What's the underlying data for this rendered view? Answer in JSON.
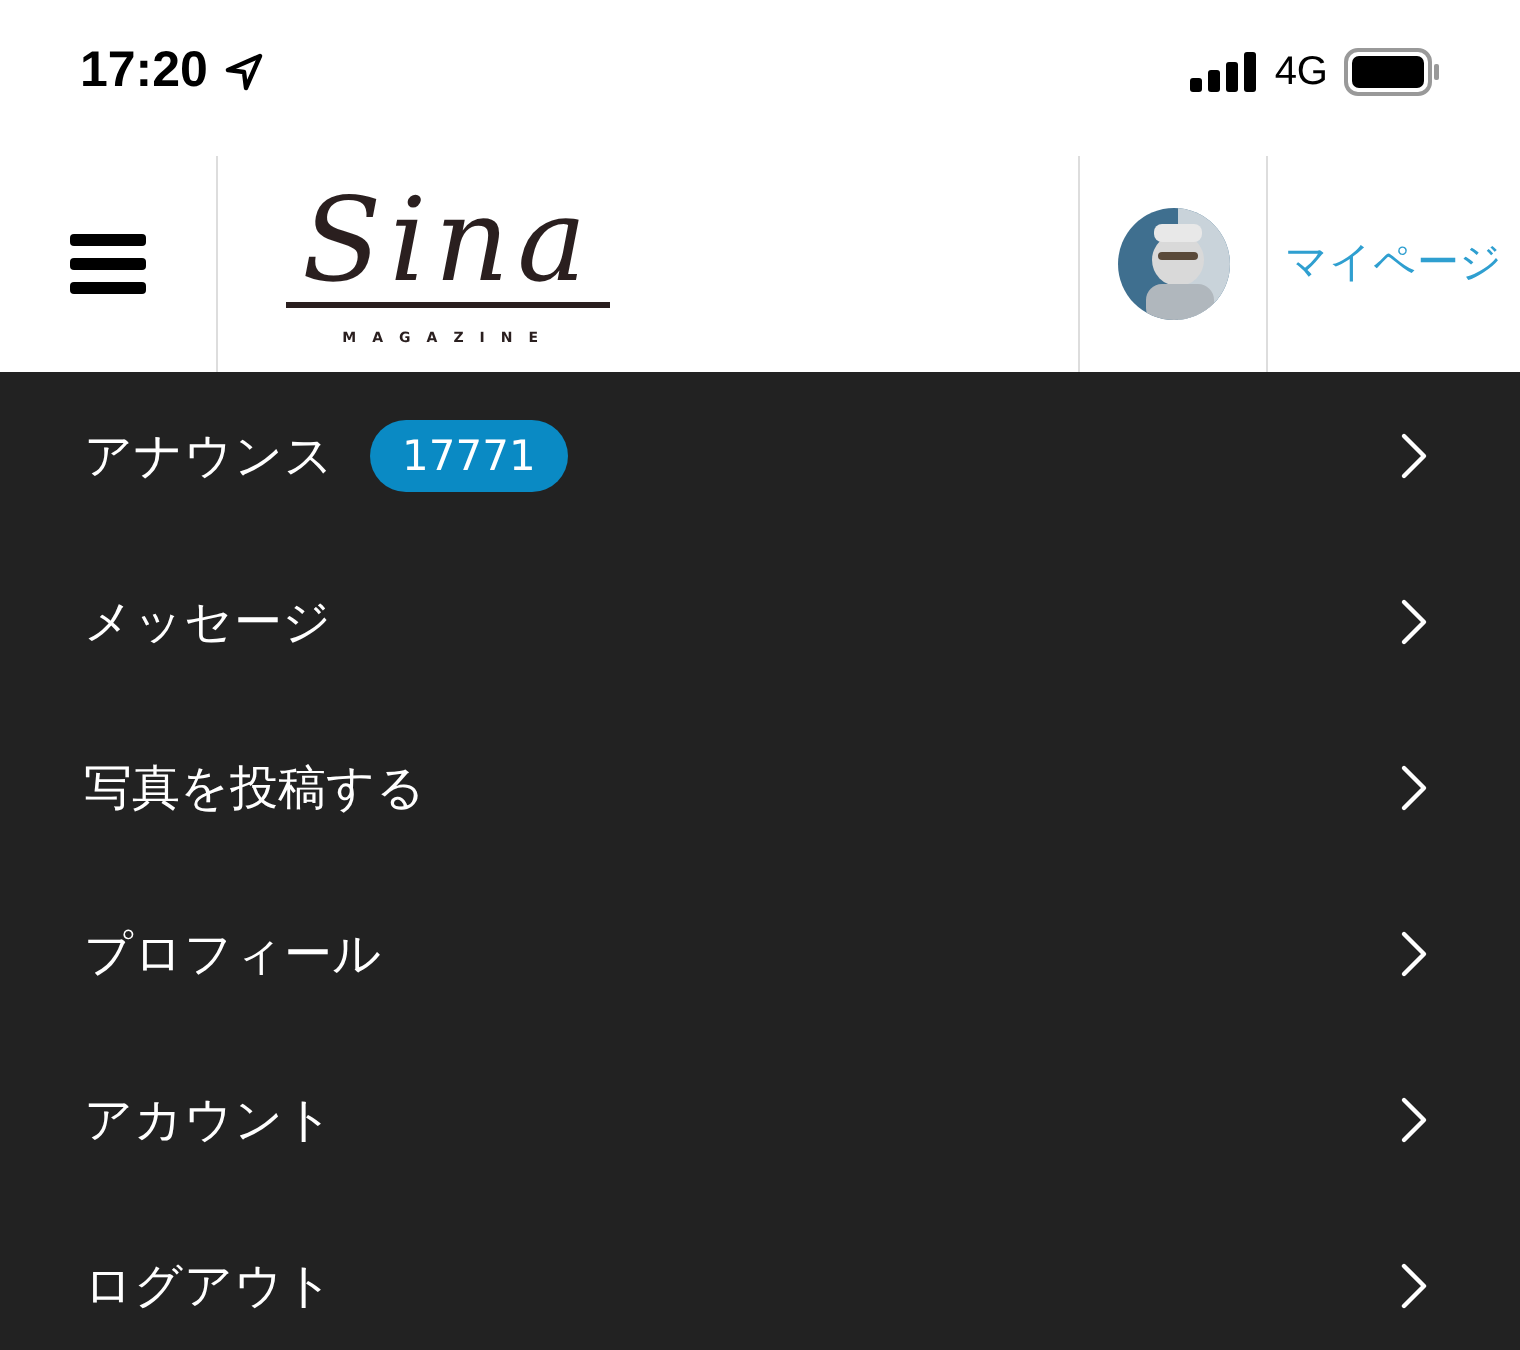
{
  "status_bar": {
    "time": "17:20",
    "network": "4G"
  },
  "header": {
    "logo": {
      "title": "Sina",
      "subtitle": "MAGAZINE"
    },
    "mypage_link": "マイページ"
  },
  "menu": [
    {
      "label": "アナウンス",
      "badge": "17771"
    },
    {
      "label": "メッセージ"
    },
    {
      "label": "写真を投稿する"
    },
    {
      "label": "プロフィール"
    },
    {
      "label": "アカウント"
    },
    {
      "label": "ログアウト"
    }
  ]
}
